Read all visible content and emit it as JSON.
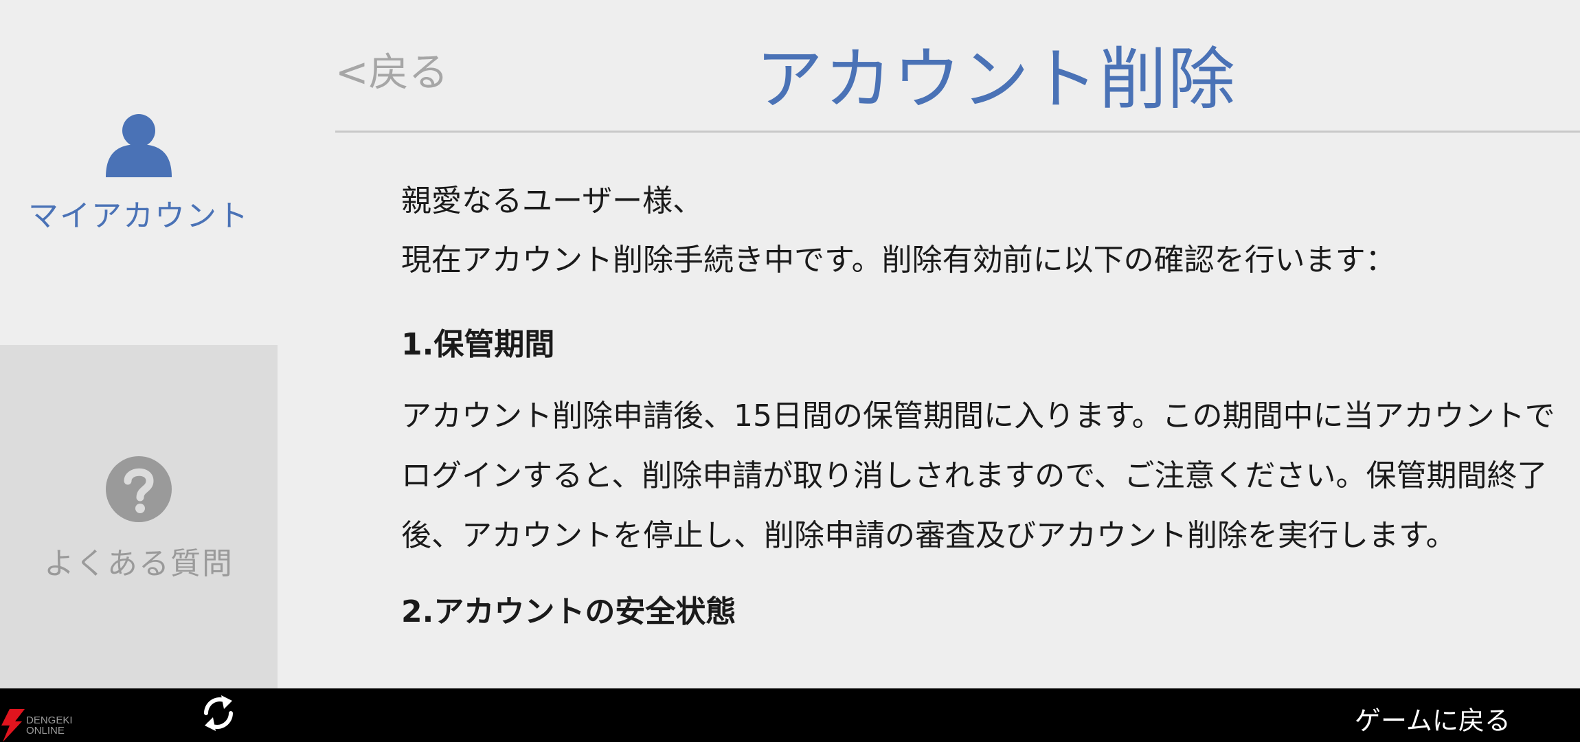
{
  "sidebar": {
    "items": [
      {
        "label": "マイアカウント",
        "icon": "person-icon",
        "active": true
      },
      {
        "label": "よくある質問",
        "icon": "question-icon",
        "active": false
      }
    ]
  },
  "header": {
    "back_label": "<戻る",
    "title": "アカウント削除"
  },
  "content": {
    "greeting": "親愛なるユーザー様、",
    "intro": "現在アカウント削除手続き中です。削除有効前に以下の確認を行います：",
    "section1_heading": "1.保管期間",
    "section1_body": "アカウント削除申請後、15日間の保管期間に入ります。この期間中に当アカウントでログインすると、削除申請が取り消しされますので、ご注意ください。保管期間終了後、アカウントを停止し、削除申請の審査及びアカウント削除を実行します。",
    "section2_heading": "2.アカウントの安全状態"
  },
  "bottom_bar": {
    "brand_text_line1": "DENGEKI",
    "brand_text_line2": "ONLINE",
    "refresh_icon": "refresh-icon",
    "return_label": "ゲームに戻る"
  },
  "colors": {
    "accent": "#4a72b6",
    "background": "#eeeeee",
    "sidebar_inactive_bg": "#dcdcdc",
    "bottom_bar": "#000000"
  }
}
